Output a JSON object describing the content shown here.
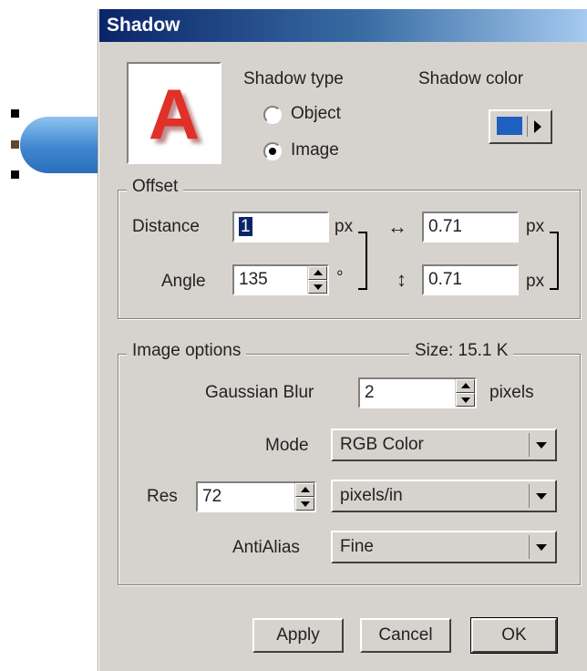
{
  "dialog": {
    "title": "Shadow"
  },
  "preview": {
    "letter": "A"
  },
  "shadow_type": {
    "label": "Shadow type",
    "options": [
      {
        "label": "Object",
        "selected": false
      },
      {
        "label": "Image",
        "selected": true
      }
    ]
  },
  "shadow_color": {
    "label": "Shadow color",
    "color": "#1f5fc0"
  },
  "offset": {
    "label": "Offset",
    "distance_label": "Distance",
    "distance_value": "1",
    "distance_unit": "px",
    "angle_label": "Angle",
    "angle_value": "135",
    "angle_unit": "°",
    "horizontal_value": "0.71",
    "horizontal_unit": "px",
    "vertical_value": "0.71",
    "vertical_unit": "px"
  },
  "image_options": {
    "label": "Image options",
    "size_label": "Size: 15.1 K",
    "gaussian_blur_label": "Gaussian Blur",
    "gaussian_blur_value": "2",
    "gaussian_blur_unit": "pixels",
    "mode_label": "Mode",
    "mode_value": "RGB Color",
    "res_label": "Res",
    "res_value": "72",
    "res_unit_value": "pixels/in",
    "antialias_label": "AntiAlias",
    "antialias_value": "Fine"
  },
  "buttons": {
    "apply": "Apply",
    "cancel": "Cancel",
    "ok": "OK"
  }
}
